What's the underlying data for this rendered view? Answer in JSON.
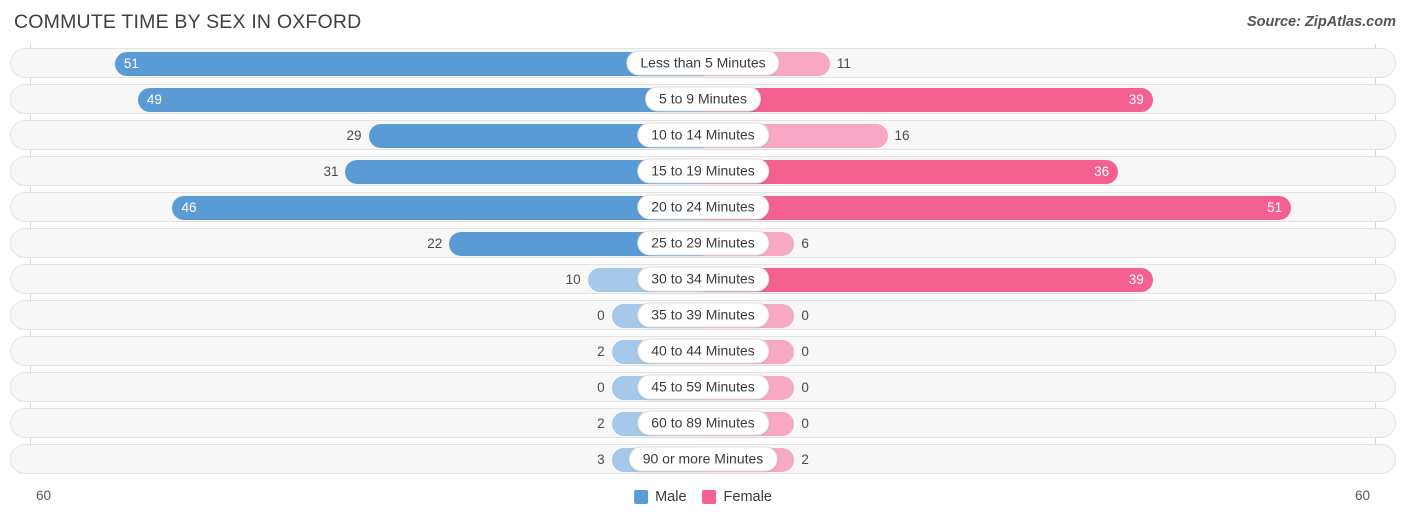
{
  "header": {
    "title": "COMMUTE TIME BY SEX IN OXFORD",
    "source": "Source: ZipAtlas.com"
  },
  "axis": {
    "left_tick": "60",
    "right_tick": "60",
    "max": 60
  },
  "legend": {
    "items": [
      {
        "label": "Male",
        "color": "#5b9bd5"
      },
      {
        "label": "Female",
        "color": "#f4608f"
      }
    ]
  },
  "colors": {
    "male_strong": "#5b9bd5",
    "male_light": "#a6c9e9",
    "female_strong": "#f4608f",
    "female_light": "#f7a8c4",
    "track": "#f7f7f7",
    "track_border": "#e3e3e3"
  },
  "chart_data": {
    "type": "bar",
    "title": "COMMUTE TIME BY SEX IN OXFORD",
    "orientation": "horizontal-diverging",
    "xlabel": "",
    "ylabel": "",
    "xlim": [
      60,
      60
    ],
    "grid": false,
    "legend_position": "bottom-center",
    "categories": [
      "Less than 5 Minutes",
      "5 to 9 Minutes",
      "10 to 14 Minutes",
      "15 to 19 Minutes",
      "20 to 24 Minutes",
      "25 to 29 Minutes",
      "30 to 34 Minutes",
      "35 to 39 Minutes",
      "40 to 44 Minutes",
      "45 to 59 Minutes",
      "60 to 89 Minutes",
      "90 or more Minutes"
    ],
    "series": [
      {
        "name": "Male",
        "values": [
          51,
          49,
          29,
          31,
          46,
          22,
          10,
          0,
          2,
          0,
          2,
          3
        ]
      },
      {
        "name": "Female",
        "values": [
          11,
          39,
          16,
          36,
          51,
          6,
          39,
          0,
          0,
          0,
          0,
          2
        ]
      }
    ]
  }
}
